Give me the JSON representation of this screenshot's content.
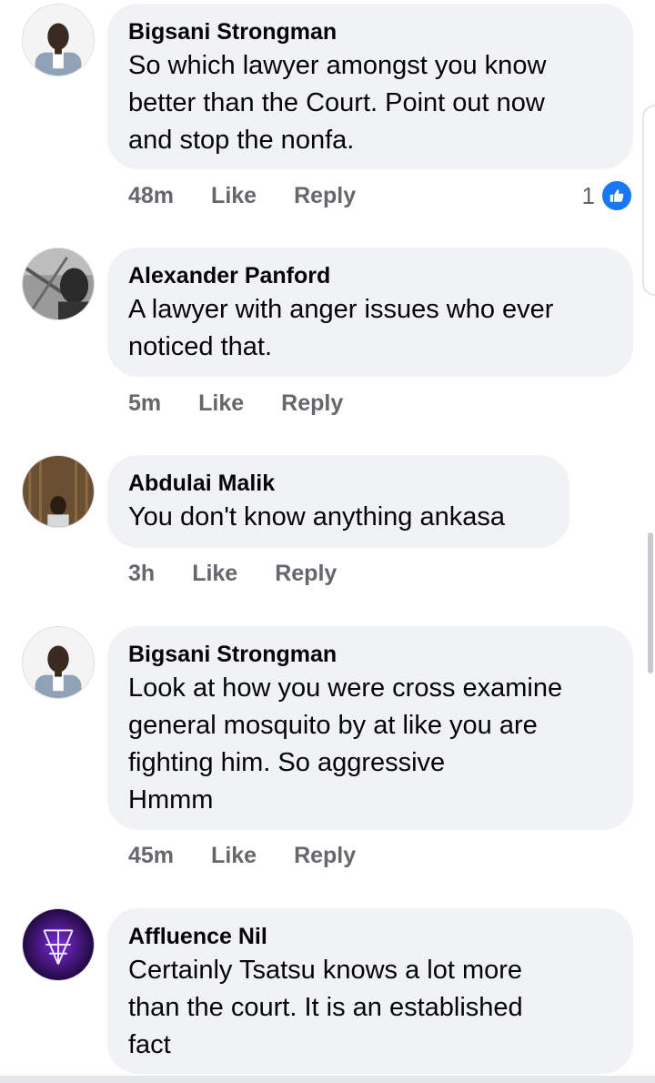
{
  "comments": [
    {
      "author": "Bigsani Strongman",
      "lines": [
        "So which lawyer amongst you know",
        "better than the Court. Point out now",
        "and stop the nonfa."
      ],
      "time": "48m",
      "like_label": "Like",
      "reply_label": "Reply",
      "reactions": "1",
      "reaction_icon": "thumbs-up-icon"
    },
    {
      "author": "Alexander Panford",
      "lines": [
        "A lawyer with anger issues who ever",
        "noticed that."
      ],
      "time": "5m",
      "like_label": "Like",
      "reply_label": "Reply"
    },
    {
      "author": "Abdulai Malik",
      "lines": [
        "You don't know anything ankasa"
      ],
      "time": "3h",
      "like_label": "Like",
      "reply_label": "Reply"
    },
    {
      "author": "Bigsani Strongman",
      "lines": [
        "Look at how you were cross examine",
        "general mosquito by at like you are",
        "fighting him. So aggressive",
        "Hmmm"
      ],
      "time": "45m",
      "like_label": "Like",
      "reply_label": "Reply"
    },
    {
      "author": "Affluence Nil",
      "lines": [
        "Certainly Tsatsu knows a lot more",
        "than the court. It is an established",
        "fact"
      ]
    }
  ],
  "colors": {
    "bubble": "#f0f2f5",
    "meta_text": "#65676b",
    "like_blue": "#1877f2"
  }
}
